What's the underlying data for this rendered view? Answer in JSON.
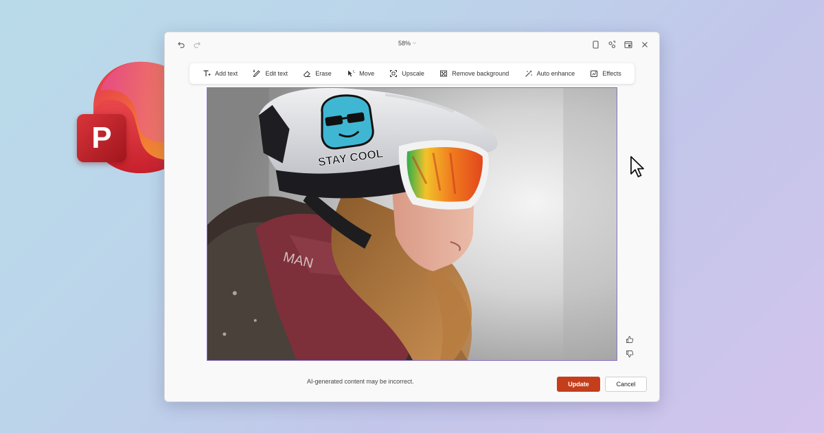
{
  "window": {
    "zoom": "58%",
    "icons": [
      "undo-icon",
      "redo-icon",
      "copy-icon",
      "share-icon",
      "panel-icon",
      "close-icon"
    ]
  },
  "toolbar": {
    "tools": [
      {
        "label": "Add text",
        "icon": "add-text-icon"
      },
      {
        "label": "Edit text",
        "icon": "edit-text-icon"
      },
      {
        "label": "Erase",
        "icon": "eraser-icon"
      },
      {
        "label": "Move",
        "icon": "move-icon"
      },
      {
        "label": "Upscale",
        "icon": "upscale-icon"
      },
      {
        "label": "Remove background",
        "icon": "remove-background-icon"
      },
      {
        "label": "Auto enhance",
        "icon": "auto-enhance-icon"
      },
      {
        "label": "Effects",
        "icon": "effects-icon"
      }
    ]
  },
  "image": {
    "sticker_text": "STAY COOL",
    "jacket_text": "MAN"
  },
  "footer": {
    "disclaimer": "AI-generated content may be incorrect.",
    "update_label": "Update",
    "cancel_label": "Cancel"
  },
  "logo": {
    "letter": "P",
    "colors": {
      "letter_bg": "#c4262e",
      "orange": "#f7941d",
      "pink": "#e74c8c"
    }
  },
  "colors": {
    "accent": "#c43e1c",
    "selection": "#8a6fc7"
  }
}
